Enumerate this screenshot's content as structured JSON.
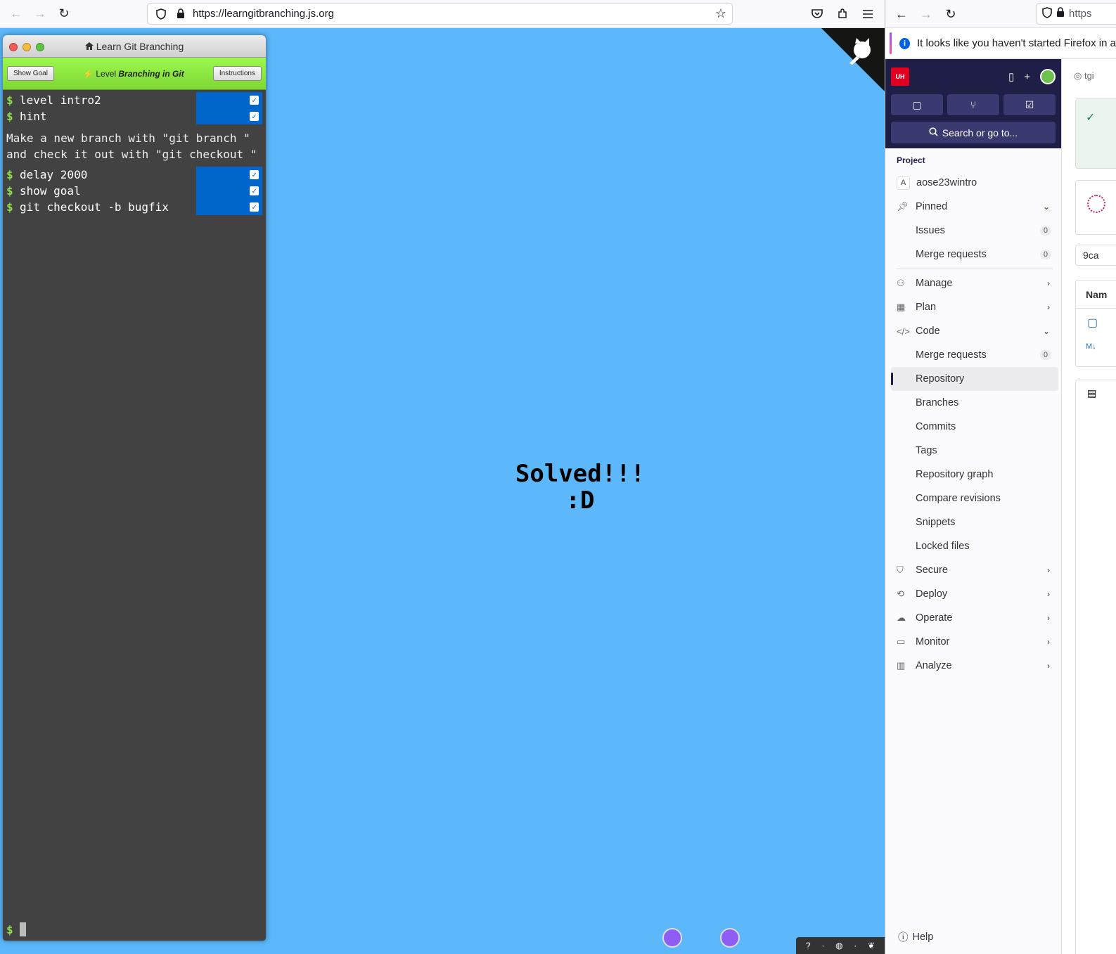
{
  "left_browser": {
    "url_host": "https://learngitbranching.js.org",
    "terminal": {
      "title": "Learn Git Branching",
      "show_goal": "Show Goal",
      "instructions": "Instructions",
      "level_prefix": "Level",
      "level_name": "Branching in Git",
      "commands_top": [
        "level intro2",
        "hint"
      ],
      "hint_text": "Make a new branch with \"git branch \"\nand check it out with \"git checkout \"",
      "commands_bottom": [
        "delay 2000",
        "show goal",
        "git checkout -b bugfix"
      ],
      "prompt": "$"
    },
    "solved_line1": "Solved!!!",
    "solved_line2": ":D"
  },
  "right_browser": {
    "url_partial": "https",
    "notification": "It looks like you haven't started Firefox in a",
    "search_label": "Search or go to...",
    "section_title": "Project",
    "project_name": "aose23wintro",
    "project_initial": "A",
    "nav": {
      "pinned": "Pinned",
      "issues": "Issues",
      "issues_count": "0",
      "merge_requests": "Merge requests",
      "mr_count": "0",
      "manage": "Manage",
      "plan": "Plan",
      "code": "Code",
      "code_mr": "Merge requests",
      "code_mr_count": "0",
      "repository": "Repository",
      "branches": "Branches",
      "commits": "Commits",
      "tags": "Tags",
      "repository_graph": "Repository graph",
      "compare_revisions": "Compare revisions",
      "snippets": "Snippets",
      "locked_files": "Locked files",
      "secure": "Secure",
      "deploy": "Deploy",
      "operate": "Operate",
      "monitor": "Monitor",
      "analyze": "Analyze"
    },
    "help": "Help",
    "main_fragments": {
      "breadcrumb": "tgi",
      "sha": "9ca",
      "name_header": "Nam"
    }
  },
  "colors": {
    "stage_blue": "#5cb8fa",
    "terminal_bg": "#424242",
    "level_bar_green": "#8ae840",
    "command_status_blue": "#0066cc",
    "gitlab_nav_dark": "#1f1e47",
    "node_purple": "#8e5df5"
  }
}
